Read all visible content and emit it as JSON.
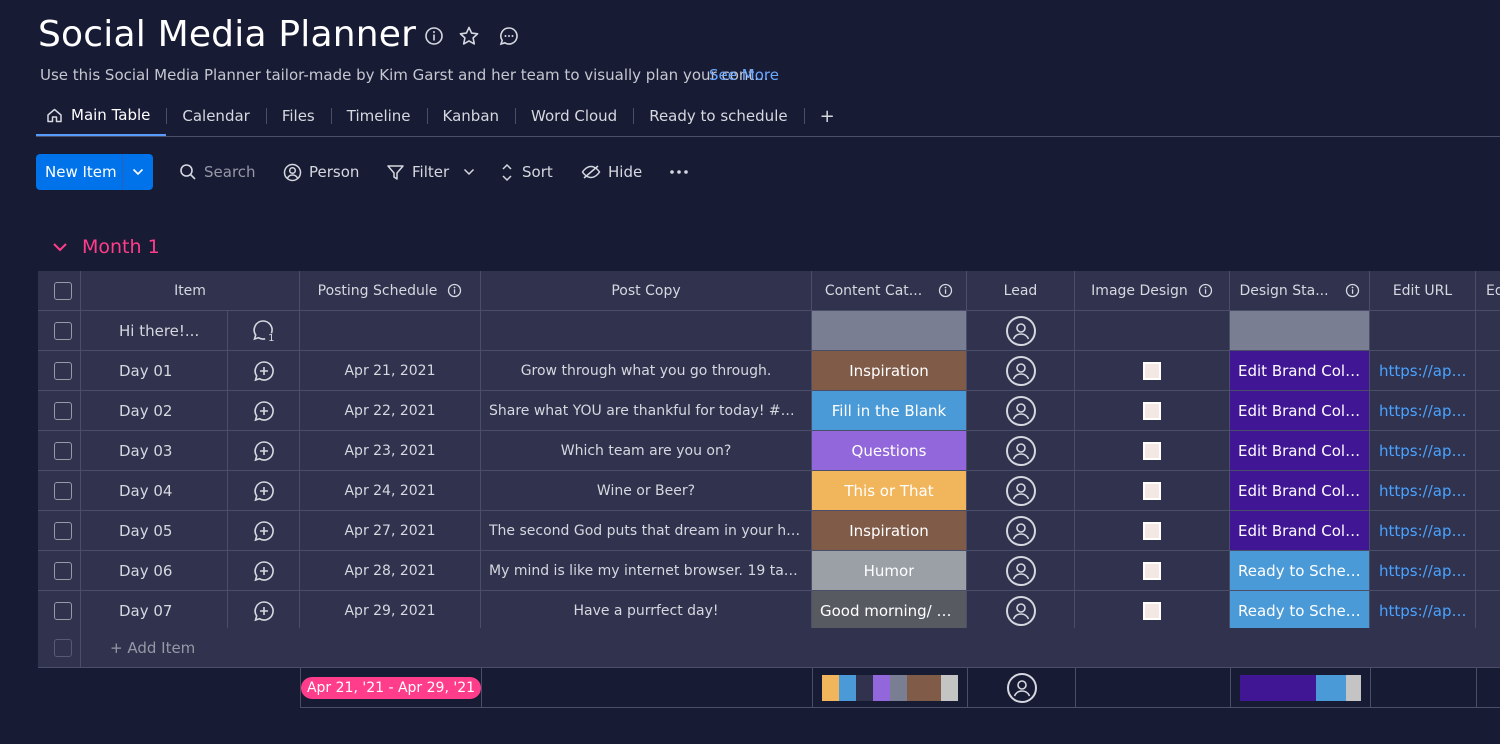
{
  "board": {
    "title": "Social Media Planner",
    "description": "Use this Social Media Planner tailor-made by Kim Garst and her team to visually plan your cont...",
    "see_more": "See More"
  },
  "tabs": [
    {
      "label": "Main Table",
      "icon": "home-icon"
    },
    {
      "label": "Calendar"
    },
    {
      "label": "Files"
    },
    {
      "label": "Timeline"
    },
    {
      "label": "Kanban"
    },
    {
      "label": "Word Cloud"
    },
    {
      "label": "Ready to schedule"
    },
    {
      "label": "+"
    }
  ],
  "toolbar": {
    "new_item": "New Item",
    "search": "Search",
    "person": "Person",
    "filter": "Filter",
    "sort": "Sort",
    "hide": "Hide"
  },
  "group": {
    "name": "Month 1",
    "color": "#ff3d8b",
    "columns": [
      "Item",
      "Posting Schedule",
      "Post Copy",
      "Content Cat...",
      "Lead",
      "Image Design",
      "Design Sta...",
      "Edit URL",
      "Ed"
    ],
    "rows": [
      {
        "item": "Hi there!...",
        "updates": "1",
        "date": "",
        "copy": "",
        "category": "",
        "category_color": "#797e93",
        "design_status": "",
        "design_color": "#797e93",
        "url": "",
        "thumb": false
      },
      {
        "item": "Day 01",
        "date": "Apr 21, 2021",
        "copy": "Grow through what you go through.",
        "category": "Inspiration",
        "category_color": "#7f5b48",
        "design_status": "Edit Brand Colors",
        "design_color": "#401694",
        "url": "https://app...",
        "thumb": true
      },
      {
        "item": "Day 02",
        "date": "Apr 22, 2021",
        "copy": "Share what YOU are thankful for today! #Thank...",
        "category": "Fill in the Blank",
        "category_color": "#4a9ad7",
        "design_status": "Edit Brand Colors",
        "design_color": "#401694",
        "url": "https://app...",
        "thumb": true
      },
      {
        "item": "Day 03",
        "date": "Apr 23, 2021",
        "copy": "Which team are you on?",
        "category": "Questions",
        "category_color": "#9167db",
        "design_status": "Edit Brand Colors",
        "design_color": "#401694",
        "url": "https://app...",
        "thumb": true
      },
      {
        "item": "Day 04",
        "date": "Apr 24, 2021",
        "copy": "Wine or Beer?",
        "category": "This or That",
        "category_color": "#f1b65c",
        "design_status": "Edit Brand Colors",
        "design_color": "#401694",
        "url": "https://app...",
        "thumb": true
      },
      {
        "item": "Day 05",
        "date": "Apr 27, 2021",
        "copy": "The second God puts that dream in your heart, ...",
        "category": "Inspiration",
        "category_color": "#7f5b48",
        "design_status": "Edit Brand Colors",
        "design_color": "#401694",
        "url": "https://app...",
        "thumb": true
      },
      {
        "item": "Day 06",
        "date": "Apr 28, 2021",
        "copy": "My mind is like my internet browser. 19 tabs op...",
        "category": "Humor",
        "category_color": "#9aa0a6",
        "design_status": "Ready to Sched...",
        "design_color": "#4a9ad7",
        "url": "https://app...",
        "thumb": true
      },
      {
        "item": "Day 07",
        "date": "Apr 29, 2021",
        "copy": "Have a purrfect day!",
        "category": "Good morning/ g...",
        "category_color": "#585a62",
        "design_status": "Ready to Sched...",
        "design_color": "#4a9ad7",
        "url": "https://app...",
        "thumb": true
      }
    ],
    "add_item": "+ Add Item",
    "date_summary": "Apr 21, '21 - Apr 29, '21"
  }
}
